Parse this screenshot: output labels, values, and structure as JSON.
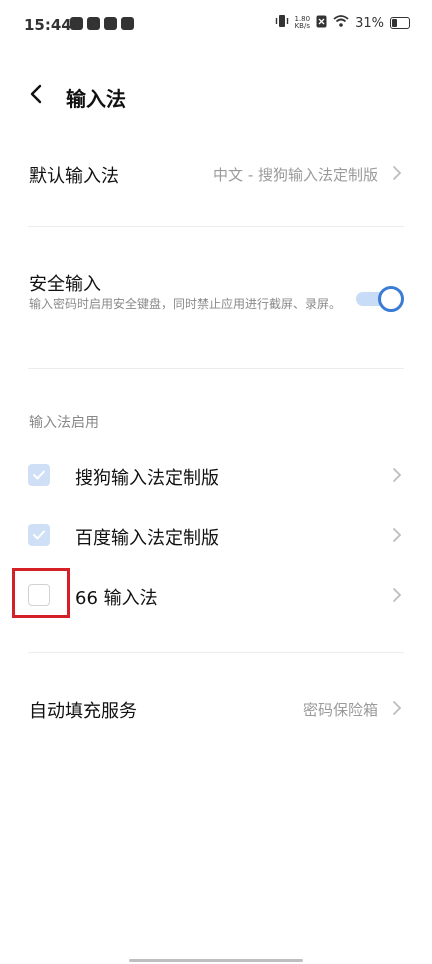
{
  "status_bar": {
    "time": "15:44",
    "net_speed_value": "1.80",
    "net_speed_unit": "KB/s",
    "battery": "31%"
  },
  "header": {
    "title": "输入法"
  },
  "default_input": {
    "label": "默认输入法",
    "value": "中文 - 搜狗输入法定制版"
  },
  "secure_input": {
    "label": "安全输入",
    "description": "输入密码时启用安全键盘，同时禁止应用进行截屏、录屏。",
    "enabled": true
  },
  "enabled_section": {
    "title": "输入法启用",
    "items": [
      {
        "label": "搜狗输入法定制版",
        "checked": true
      },
      {
        "label": "百度输入法定制版",
        "checked": true
      },
      {
        "label": "66 输入法",
        "checked": false
      }
    ]
  },
  "autofill": {
    "label": "自动填充服务",
    "value": "密码保险箱"
  },
  "colors": {
    "accent": "#3a7bd5",
    "highlight": "#d62028"
  }
}
